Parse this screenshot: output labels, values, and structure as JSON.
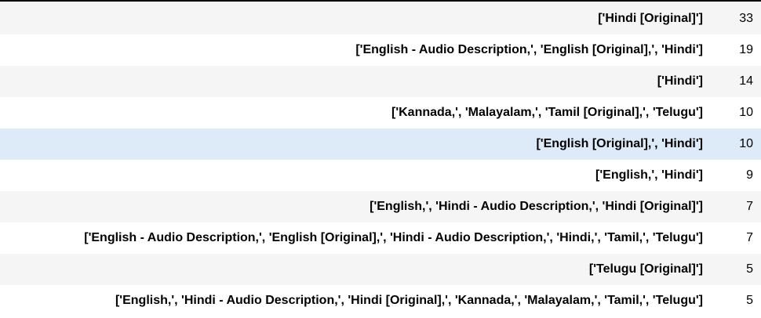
{
  "table": {
    "rows": [
      {
        "index": "['Hindi [Original]']",
        "value": "33"
      },
      {
        "index": "['English - Audio Description,', 'English [Original],', 'Hindi']",
        "value": "19"
      },
      {
        "index": "['Hindi']",
        "value": "14"
      },
      {
        "index": "['Kannada,', 'Malayalam,', 'Tamil [Original],', 'Telugu']",
        "value": "10"
      },
      {
        "index": "['English [Original],', 'Hindi']",
        "value": "10"
      },
      {
        "index": "['English,', 'Hindi']",
        "value": "9"
      },
      {
        "index": "['English,', 'Hindi - Audio Description,', 'Hindi [Original]']",
        "value": "7"
      },
      {
        "index": "['English - Audio Description,', 'English [Original],', 'Hindi - Audio Description,', 'Hindi,', 'Tamil,', 'Telugu']",
        "value": "7"
      },
      {
        "index": "['Telugu [Original]']",
        "value": "5"
      },
      {
        "index": "['English,', 'Hindi - Audio Description,', 'Hindi [Original],', 'Kannada,', 'Malayalam,', 'Tamil,', 'Telugu']",
        "value": "5"
      }
    ],
    "highlighted_row": 4,
    "colors": {
      "stripe": "#f5f5f5",
      "highlight": "#ddeaf8",
      "header_rule": "#000000"
    }
  }
}
